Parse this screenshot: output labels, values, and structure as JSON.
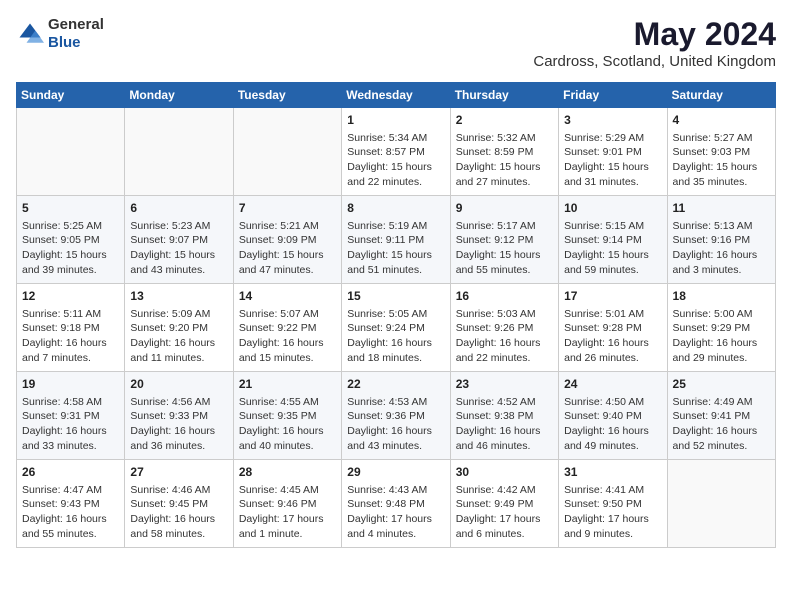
{
  "header": {
    "logo_general": "General",
    "logo_blue": "Blue",
    "title": "May 2024",
    "subtitle": "Cardross, Scotland, United Kingdom"
  },
  "days_of_week": [
    "Sunday",
    "Monday",
    "Tuesday",
    "Wednesday",
    "Thursday",
    "Friday",
    "Saturday"
  ],
  "weeks": [
    [
      {
        "day": "",
        "info": ""
      },
      {
        "day": "",
        "info": ""
      },
      {
        "day": "",
        "info": ""
      },
      {
        "day": "1",
        "info": "Sunrise: 5:34 AM\nSunset: 8:57 PM\nDaylight: 15 hours\nand 22 minutes."
      },
      {
        "day": "2",
        "info": "Sunrise: 5:32 AM\nSunset: 8:59 PM\nDaylight: 15 hours\nand 27 minutes."
      },
      {
        "day": "3",
        "info": "Sunrise: 5:29 AM\nSunset: 9:01 PM\nDaylight: 15 hours\nand 31 minutes."
      },
      {
        "day": "4",
        "info": "Sunrise: 5:27 AM\nSunset: 9:03 PM\nDaylight: 15 hours\nand 35 minutes."
      }
    ],
    [
      {
        "day": "5",
        "info": "Sunrise: 5:25 AM\nSunset: 9:05 PM\nDaylight: 15 hours\nand 39 minutes."
      },
      {
        "day": "6",
        "info": "Sunrise: 5:23 AM\nSunset: 9:07 PM\nDaylight: 15 hours\nand 43 minutes."
      },
      {
        "day": "7",
        "info": "Sunrise: 5:21 AM\nSunset: 9:09 PM\nDaylight: 15 hours\nand 47 minutes."
      },
      {
        "day": "8",
        "info": "Sunrise: 5:19 AM\nSunset: 9:11 PM\nDaylight: 15 hours\nand 51 minutes."
      },
      {
        "day": "9",
        "info": "Sunrise: 5:17 AM\nSunset: 9:12 PM\nDaylight: 15 hours\nand 55 minutes."
      },
      {
        "day": "10",
        "info": "Sunrise: 5:15 AM\nSunset: 9:14 PM\nDaylight: 15 hours\nand 59 minutes."
      },
      {
        "day": "11",
        "info": "Sunrise: 5:13 AM\nSunset: 9:16 PM\nDaylight: 16 hours\nand 3 minutes."
      }
    ],
    [
      {
        "day": "12",
        "info": "Sunrise: 5:11 AM\nSunset: 9:18 PM\nDaylight: 16 hours\nand 7 minutes."
      },
      {
        "day": "13",
        "info": "Sunrise: 5:09 AM\nSunset: 9:20 PM\nDaylight: 16 hours\nand 11 minutes."
      },
      {
        "day": "14",
        "info": "Sunrise: 5:07 AM\nSunset: 9:22 PM\nDaylight: 16 hours\nand 15 minutes."
      },
      {
        "day": "15",
        "info": "Sunrise: 5:05 AM\nSunset: 9:24 PM\nDaylight: 16 hours\nand 18 minutes."
      },
      {
        "day": "16",
        "info": "Sunrise: 5:03 AM\nSunset: 9:26 PM\nDaylight: 16 hours\nand 22 minutes."
      },
      {
        "day": "17",
        "info": "Sunrise: 5:01 AM\nSunset: 9:28 PM\nDaylight: 16 hours\nand 26 minutes."
      },
      {
        "day": "18",
        "info": "Sunrise: 5:00 AM\nSunset: 9:29 PM\nDaylight: 16 hours\nand 29 minutes."
      }
    ],
    [
      {
        "day": "19",
        "info": "Sunrise: 4:58 AM\nSunset: 9:31 PM\nDaylight: 16 hours\nand 33 minutes."
      },
      {
        "day": "20",
        "info": "Sunrise: 4:56 AM\nSunset: 9:33 PM\nDaylight: 16 hours\nand 36 minutes."
      },
      {
        "day": "21",
        "info": "Sunrise: 4:55 AM\nSunset: 9:35 PM\nDaylight: 16 hours\nand 40 minutes."
      },
      {
        "day": "22",
        "info": "Sunrise: 4:53 AM\nSunset: 9:36 PM\nDaylight: 16 hours\nand 43 minutes."
      },
      {
        "day": "23",
        "info": "Sunrise: 4:52 AM\nSunset: 9:38 PM\nDaylight: 16 hours\nand 46 minutes."
      },
      {
        "day": "24",
        "info": "Sunrise: 4:50 AM\nSunset: 9:40 PM\nDaylight: 16 hours\nand 49 minutes."
      },
      {
        "day": "25",
        "info": "Sunrise: 4:49 AM\nSunset: 9:41 PM\nDaylight: 16 hours\nand 52 minutes."
      }
    ],
    [
      {
        "day": "26",
        "info": "Sunrise: 4:47 AM\nSunset: 9:43 PM\nDaylight: 16 hours\nand 55 minutes."
      },
      {
        "day": "27",
        "info": "Sunrise: 4:46 AM\nSunset: 9:45 PM\nDaylight: 16 hours\nand 58 minutes."
      },
      {
        "day": "28",
        "info": "Sunrise: 4:45 AM\nSunset: 9:46 PM\nDaylight: 17 hours\nand 1 minute."
      },
      {
        "day": "29",
        "info": "Sunrise: 4:43 AM\nSunset: 9:48 PM\nDaylight: 17 hours\nand 4 minutes."
      },
      {
        "day": "30",
        "info": "Sunrise: 4:42 AM\nSunset: 9:49 PM\nDaylight: 17 hours\nand 6 minutes."
      },
      {
        "day": "31",
        "info": "Sunrise: 4:41 AM\nSunset: 9:50 PM\nDaylight: 17 hours\nand 9 minutes."
      },
      {
        "day": "",
        "info": ""
      }
    ]
  ]
}
